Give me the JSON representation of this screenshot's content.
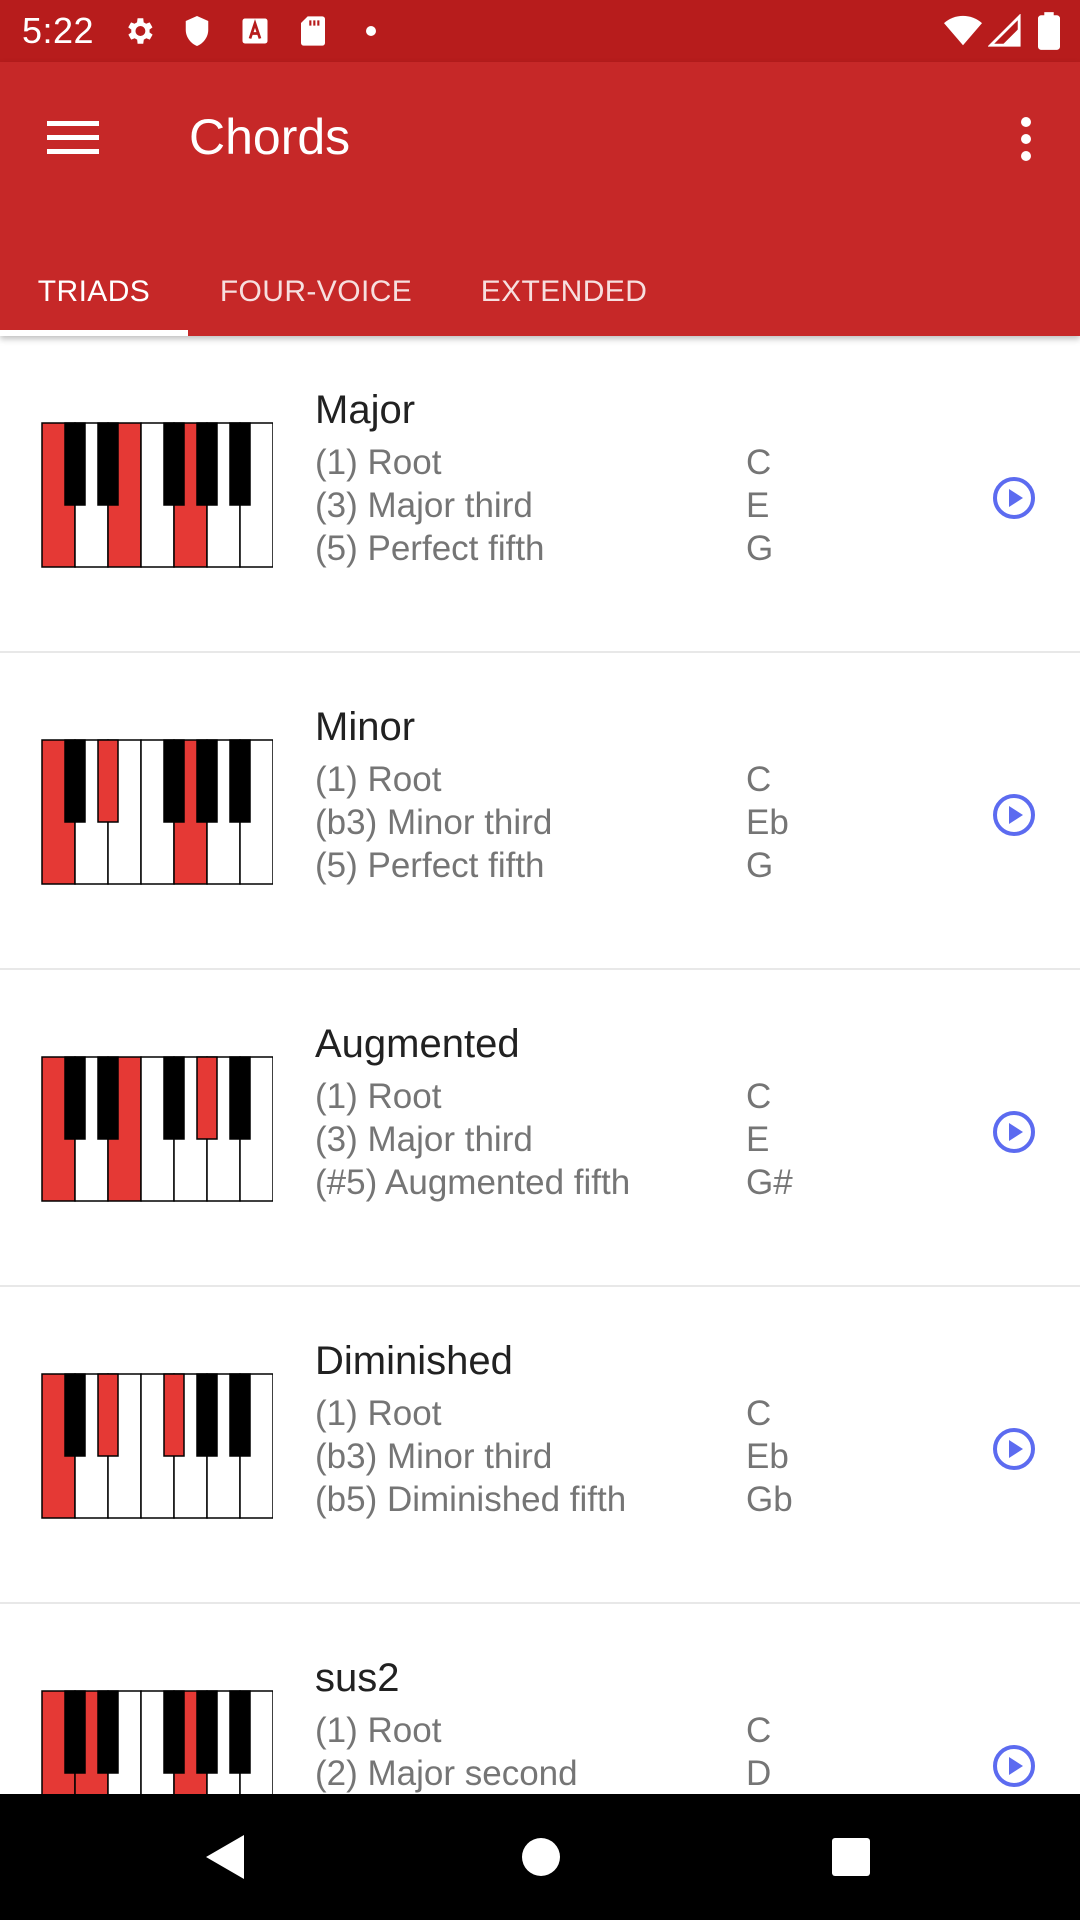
{
  "status_bar": {
    "time": "5:22",
    "left_icons": [
      "gear-icon",
      "shield-icon",
      "a-icon",
      "sd-card-icon",
      "dot-icon"
    ],
    "right_icons": [
      "wifi-icon",
      "signal-icon",
      "battery-icon"
    ]
  },
  "app_bar": {
    "title": "Chords",
    "menu_icon": "hamburger-menu-icon",
    "overflow_icon": "more-vert-icon",
    "color": "#c62828",
    "status_color": "#b71c1c"
  },
  "tabs": [
    {
      "label": "TRIADS",
      "active": true
    },
    {
      "label": "FOUR-VOICE",
      "active": false
    },
    {
      "label": "EXTENDED",
      "active": false
    }
  ],
  "colors": {
    "highlight": "#e53935",
    "play_accent": "#5c6bf0"
  },
  "chords": [
    {
      "name": "Major",
      "intervals": [
        "(1) Root",
        "(3) Major third",
        "(5) Perfect fifth"
      ],
      "notes": [
        "C",
        "E",
        "G"
      ],
      "highlighted_keys": [
        "C",
        "E",
        "G"
      ]
    },
    {
      "name": "Minor",
      "intervals": [
        "(1) Root",
        "(b3) Minor third",
        "(5) Perfect fifth"
      ],
      "notes": [
        "C",
        "Eb",
        "G"
      ],
      "highlighted_keys": [
        "C",
        "Eb",
        "G"
      ]
    },
    {
      "name": "Augmented",
      "intervals": [
        "(1) Root",
        "(3) Major third",
        "(#5) Augmented fifth"
      ],
      "notes": [
        "C",
        "E",
        "G#"
      ],
      "highlighted_keys": [
        "C",
        "E",
        "G#"
      ]
    },
    {
      "name": "Diminished",
      "intervals": [
        "(1) Root",
        "(b3) Minor third",
        "(b5) Diminished fifth"
      ],
      "notes": [
        "C",
        "Eb",
        "Gb"
      ],
      "highlighted_keys": [
        "C",
        "Eb",
        "Gb"
      ]
    },
    {
      "name": "sus2",
      "intervals": [
        "(1) Root",
        "(2) Major second"
      ],
      "notes": [
        "C",
        "D"
      ],
      "highlighted_keys": [
        "C",
        "D",
        "G"
      ]
    }
  ],
  "nav_bar": {
    "icons": [
      "back-icon",
      "home-icon",
      "recents-icon"
    ]
  }
}
